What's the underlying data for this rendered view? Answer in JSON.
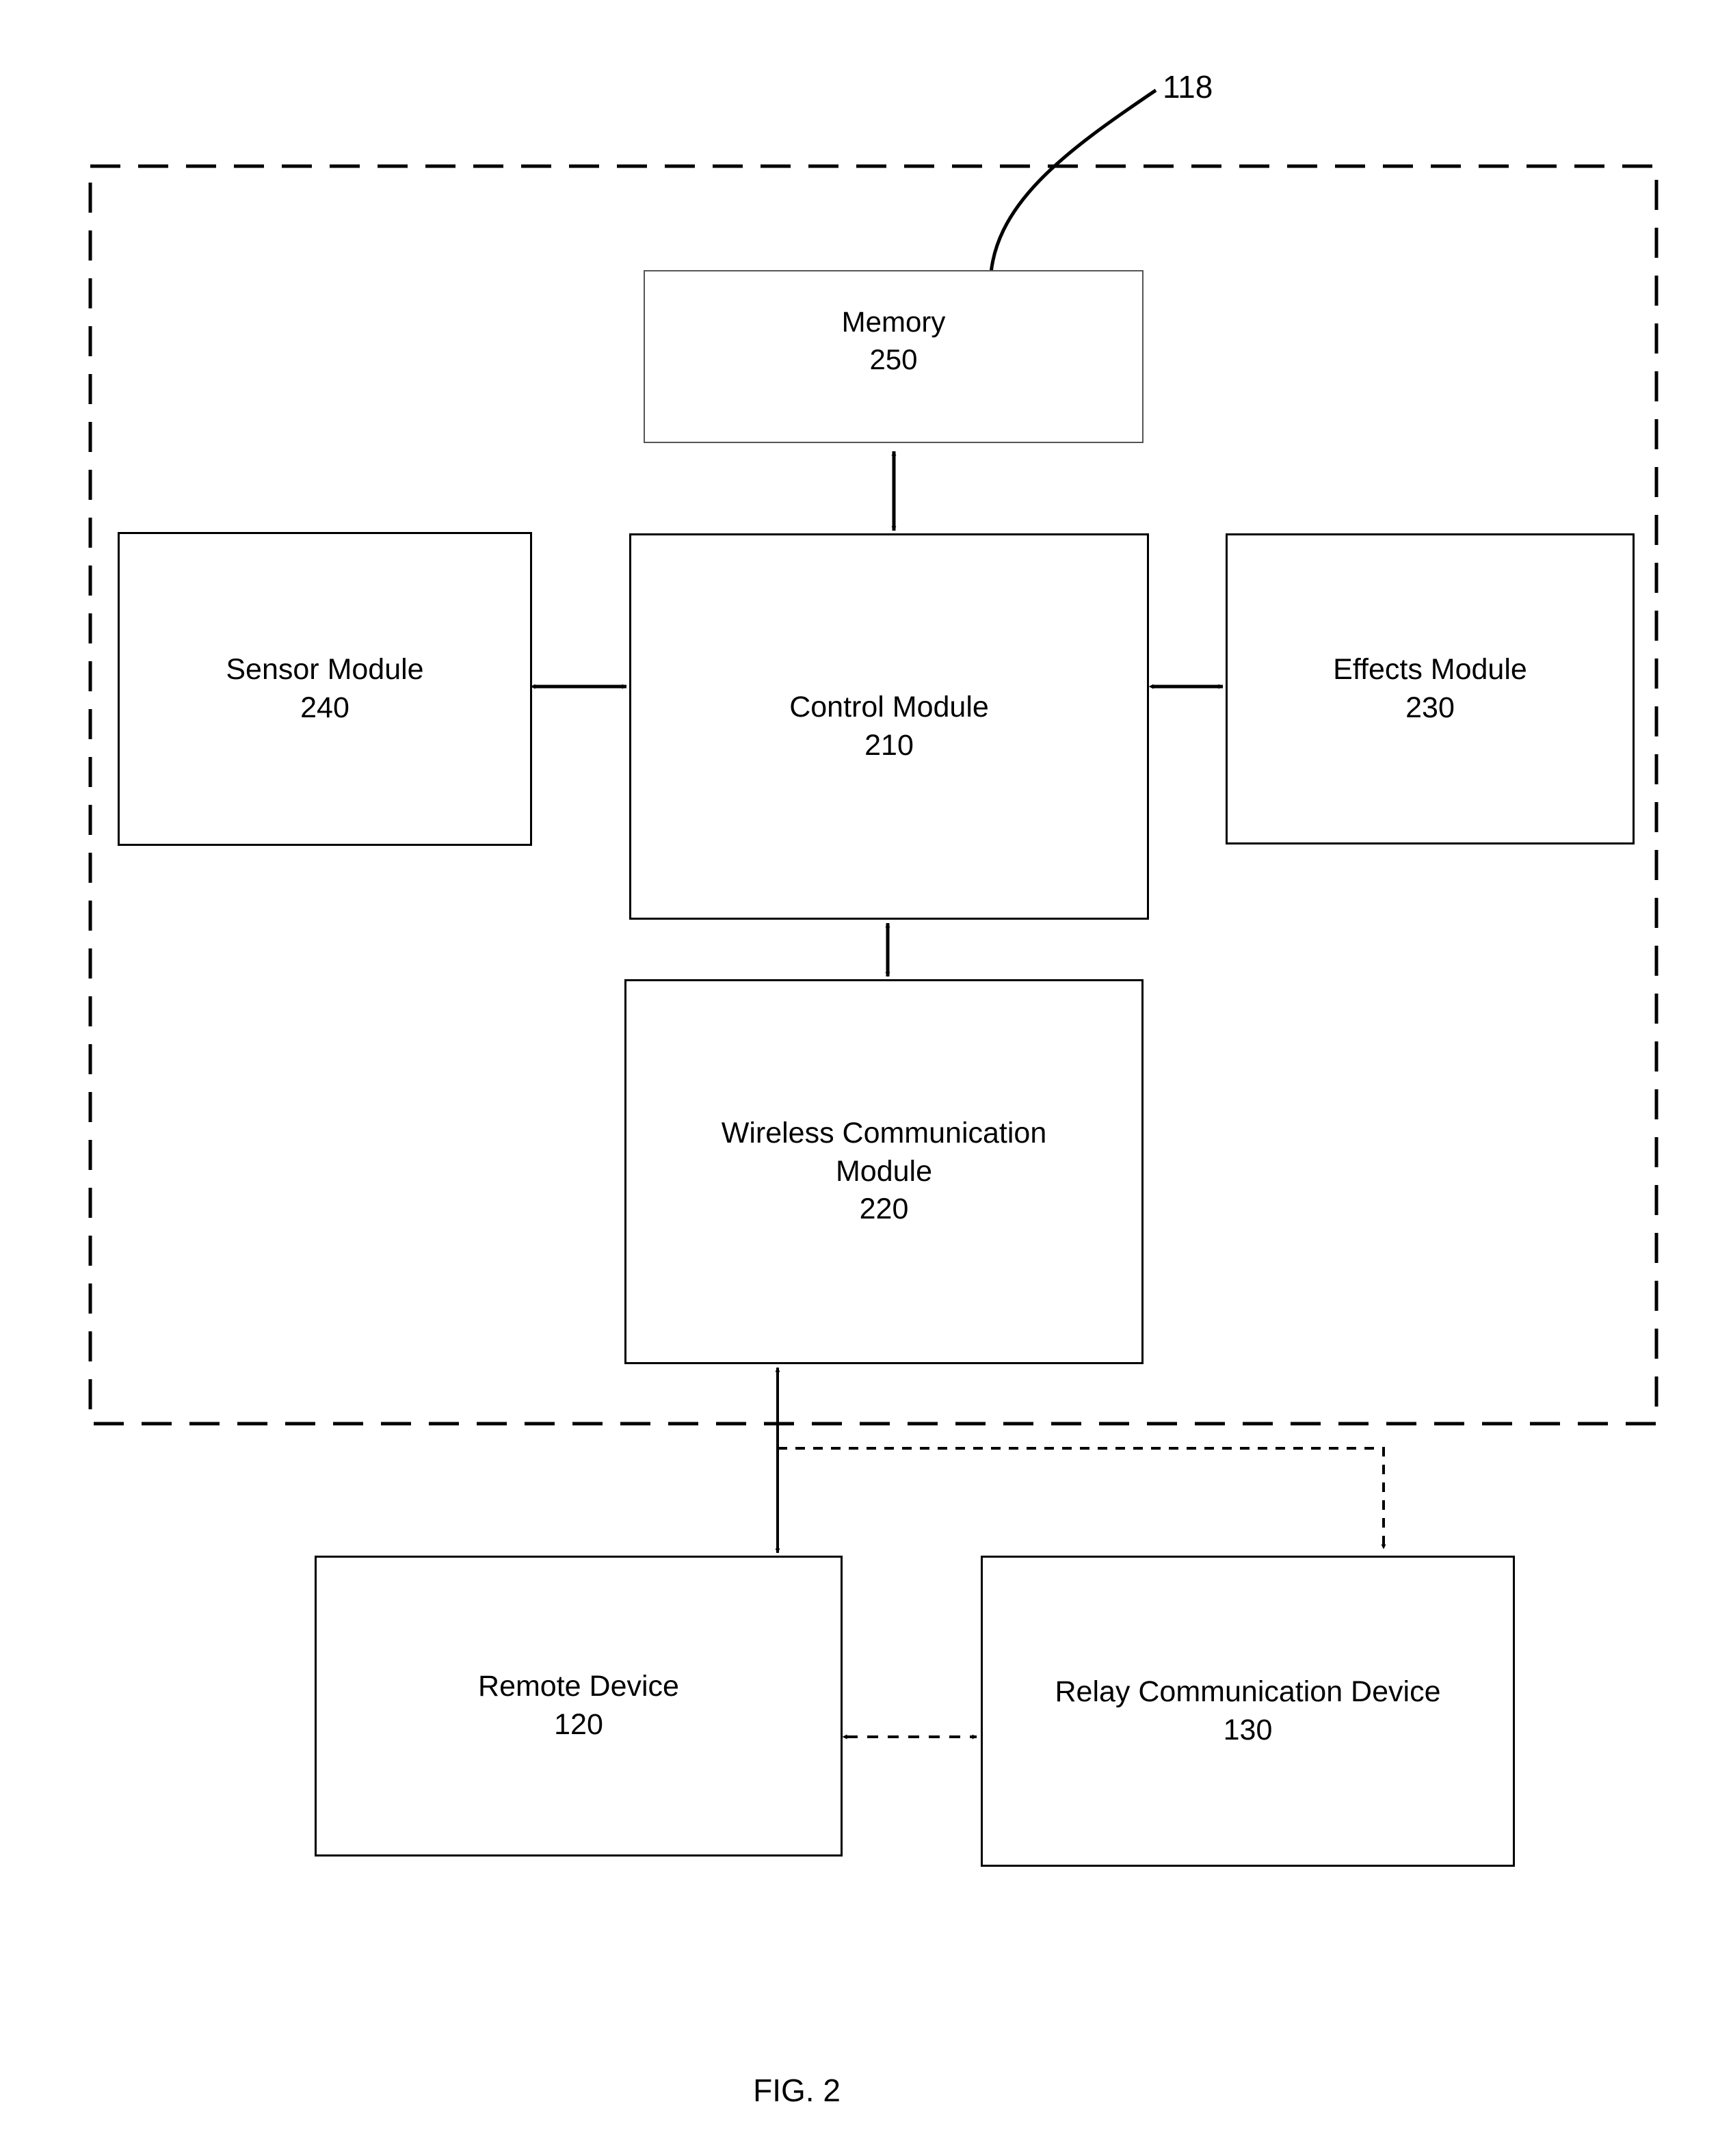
{
  "figure": {
    "caption": "FIG. 2",
    "system_reference": "118"
  },
  "nodes": {
    "memory": {
      "label": "Memory",
      "ref": "250"
    },
    "sensor": {
      "label": "Sensor Module",
      "ref": "240"
    },
    "control": {
      "label": "Control Module",
      "ref": "210"
    },
    "effects": {
      "label": "Effects Module",
      "ref": "230"
    },
    "wireless": {
      "label": "Wireless Communication",
      "label2": "Module",
      "ref": "220"
    },
    "remote": {
      "label": "Remote Device",
      "ref": "120"
    },
    "relay": {
      "label": "Relay Communication Device",
      "ref": "130"
    }
  },
  "connectors": [
    {
      "name": "memory-control",
      "from": "memory",
      "to": "control",
      "style": "solid",
      "arrows": "both"
    },
    {
      "name": "sensor-control",
      "from": "sensor",
      "to": "control",
      "style": "solid",
      "arrows": "both"
    },
    {
      "name": "control-effects",
      "from": "control",
      "to": "effects",
      "style": "solid",
      "arrows": "both"
    },
    {
      "name": "control-wireless",
      "from": "control",
      "to": "wireless",
      "style": "solid",
      "arrows": "both"
    },
    {
      "name": "wireless-remote",
      "from": "wireless",
      "to": "remote",
      "style": "dashed",
      "arrows": "both"
    },
    {
      "name": "wireless-relay",
      "from": "wireless",
      "to": "relay",
      "style": "dashed",
      "arrows": "end"
    },
    {
      "name": "remote-relay",
      "from": "remote",
      "to": "relay",
      "style": "dashed",
      "arrows": "both"
    }
  ],
  "colors": {
    "stroke": "#000000",
    "memory_stroke": "#555555",
    "background": "#ffffff"
  }
}
